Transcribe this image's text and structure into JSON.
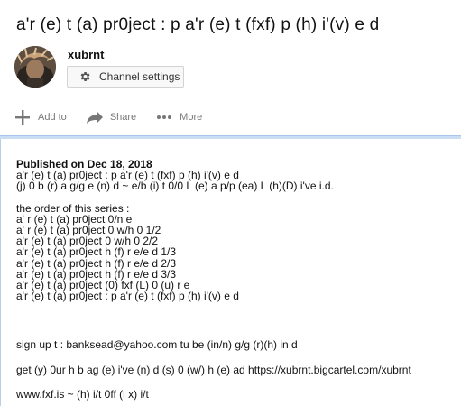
{
  "video": {
    "title": "a'r (e) t (a) pr0ject : p a'r (e) t (fxf) p (h) i'(v) e d"
  },
  "channel": {
    "name": "xubrnt",
    "settings_label": "Channel settings"
  },
  "actions": {
    "add_to": "Add to",
    "share": "Share",
    "more": "More"
  },
  "description": {
    "published": "Published on Dec 18, 2018",
    "intro": [
      "a'r (e) t (a) pr0ject : p a'r (e) t (fxf) p (h) i'(v) e d",
      "(j) 0 b (r) a g/g e (n) d ~ e/b (i) t 0/0 L (e) a p/p (ea) L (h)(D) i've i.d."
    ],
    "series_heading": "the order of this series :",
    "series": [
      "a' r (e) t (a) pr0ject 0/n e",
      "a' r (e) t (a) pr0ject 0 w/h 0 1/2",
      "a'r (e) t (a) pr0ject 0 w/h 0 2/2",
      "a'r (e) t (a) pr0ject h (f) r e/e d 1/3",
      "a'r (e) t (a) pr0ject h (f) r e/e d 2/3",
      "a'r (e) t (a) pr0ject h (f) r e/e d 3/3",
      "a'r (e) t (a) pr0ject (0) fxf (L) 0 (u) r e",
      "a'r (e) t (a) pr0ject : p a'r (e) t (fxf) p (h) i'(v) e d"
    ],
    "signup": "sign up t : banksead@yahoo.com tu be (in/n) g/g (r)(h) in d",
    "get": "get (y) 0ur h b ag (e) i've (n) d (s) 0 (w/) h (e) ad https://xubrnt.bigcartel.com/xubrnt",
    "site": "www.fxf.is ~ (h) i/t 0ff (i x) i/t"
  }
}
